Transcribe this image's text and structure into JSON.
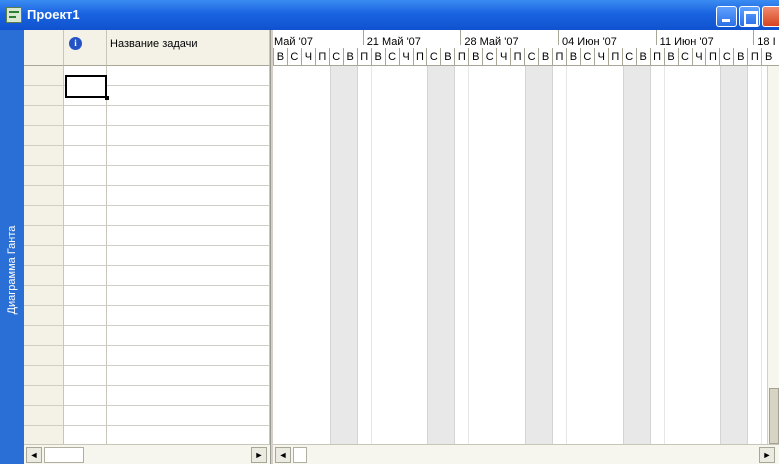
{
  "window": {
    "title": "Проект1",
    "icon": "project-document-icon",
    "controls": [
      "minimize-icon",
      "maximize-icon",
      "close-icon"
    ]
  },
  "sidebar": {
    "label": "Диаграмма Ганта"
  },
  "table": {
    "columns": [
      {
        "name": "indicators",
        "icon": "info-icon",
        "label": "i"
      },
      {
        "name": "task-name",
        "label": "Название задачи"
      }
    ],
    "row_count": 19
  },
  "timescale": {
    "weeks": [
      "Май '07",
      "21 Май '07",
      "28 Май '07",
      "04 Июн '07",
      "11 Июн '07",
      "18 І"
    ],
    "days": [
      "В",
      "С",
      "Ч",
      "П",
      "С",
      "В",
      "П",
      "В",
      "С",
      "Ч",
      "П",
      "С",
      "В",
      "П",
      "В",
      "С",
      "Ч",
      "П",
      "С",
      "В",
      "П",
      "В",
      "С",
      "Ч",
      "П",
      "С",
      "В",
      "П",
      "В",
      "С",
      "Ч",
      "П",
      "С",
      "В",
      "П",
      "В"
    ]
  },
  "scrollbars": {
    "left_arrow": "◄",
    "right_arrow": "►"
  },
  "colors": {
    "titlebar": "#1a63e0",
    "sidebar": "#2a6fd6",
    "header": "#f4f2e6",
    "weekend": "#e8e8e8"
  }
}
